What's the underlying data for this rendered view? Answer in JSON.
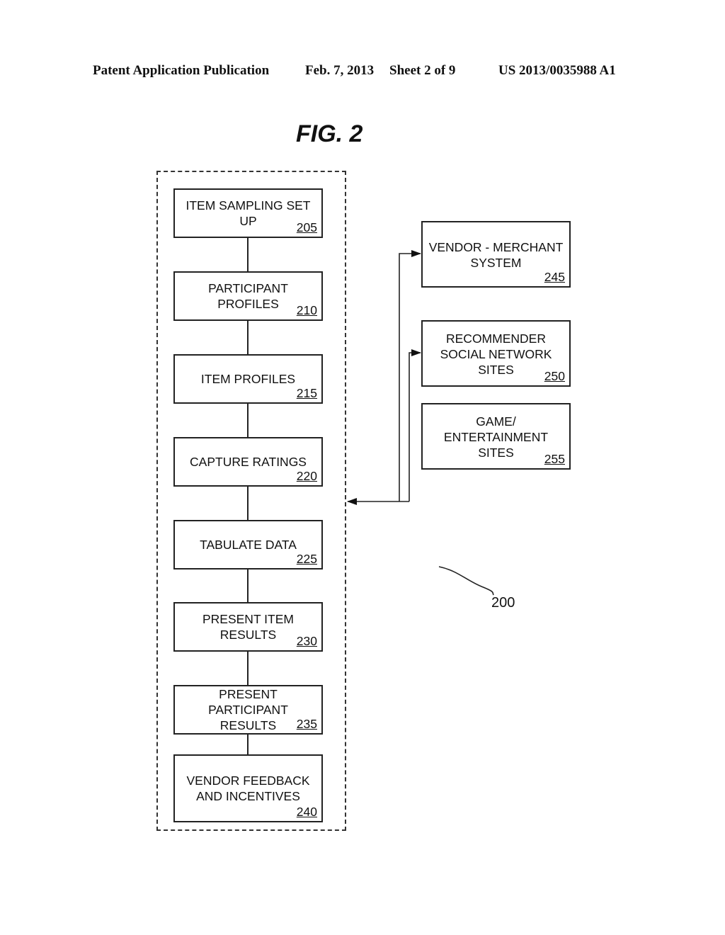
{
  "header": {
    "publication": "Patent Application Publication",
    "date": "Feb. 7, 2013",
    "sheet": "Sheet 2 of 9",
    "number": "US 2013/0035988 A1"
  },
  "figure": {
    "title": "FIG. 2",
    "reference": "200"
  },
  "flow_steps": [
    {
      "line1": "ITEM SAMPLING SET",
      "line2": "UP",
      "line3": "",
      "ref": "205"
    },
    {
      "line1": "PARTICIPANT",
      "line2": "PROFILES",
      "line3": "",
      "ref": "210"
    },
    {
      "line1": "ITEM PROFILES",
      "line2": "",
      "line3": "",
      "ref": "215"
    },
    {
      "line1": "CAPTURE RATINGS",
      "line2": "",
      "line3": "",
      "ref": "220"
    },
    {
      "line1": "TABULATE DATA",
      "line2": "",
      "line3": "",
      "ref": "225"
    },
    {
      "line1": "PRESENT ITEM",
      "line2": "RESULTS",
      "line3": "",
      "ref": "230"
    },
    {
      "line1": "PRESENT",
      "line2": "PARTICIPANT",
      "line3": "RESULTS",
      "ref": "235"
    },
    {
      "line1": "VENDOR FEEDBACK",
      "line2": "AND INCENTIVES",
      "line3": "",
      "ref": "240"
    }
  ],
  "external_systems": [
    {
      "line1": "VENDOR - MERCHANT",
      "line2": "SYSTEM",
      "line3": "",
      "ref": "245"
    },
    {
      "line1": "RECOMMENDER",
      "line2": "SOCIAL NETWORK",
      "line3": "SITES",
      "ref": "250"
    },
    {
      "line1": "GAME/",
      "line2": "ENTERTAINMENT",
      "line3": "SITES",
      "ref": "255"
    }
  ]
}
